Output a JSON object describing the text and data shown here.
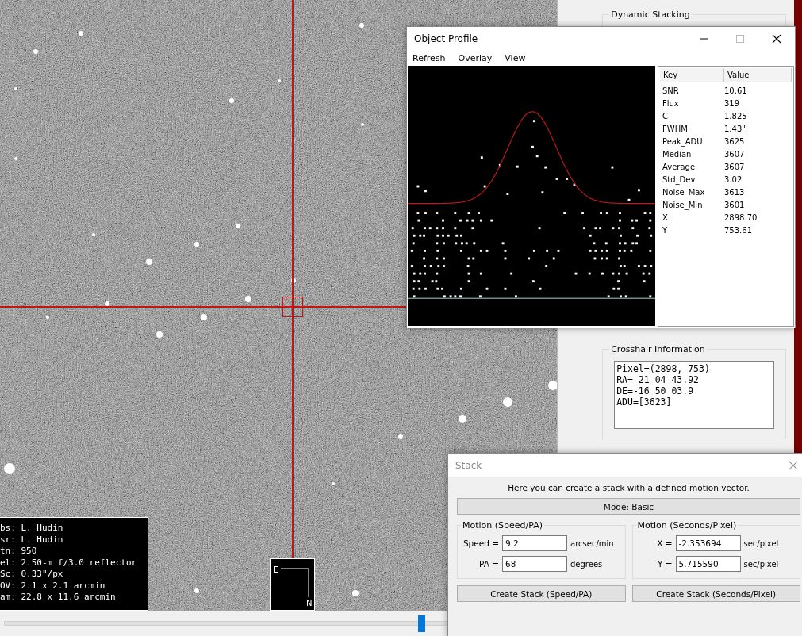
{
  "image_viewer": {
    "info_lines": [
      "bs: L. Hudin",
      "sr: L. Hudin",
      "tn: 950",
      "el: 2.50-m f/3.0 reflector",
      "Sc: 0.33\"/px",
      "OV: 2.1 x 2.1 arcmin",
      "am: 22.8 x 11.6 arcmin"
    ],
    "compass": {
      "east": "E",
      "north": "N"
    }
  },
  "zoom_slider": {
    "level": 0.94
  },
  "side_panel": {
    "dynamic_stacking": {
      "title": "Dynamic Stacking"
    },
    "crosshair_info": {
      "title": "Crosshair Information",
      "lines": [
        "Pixel=(2898, 753)",
        "RA= 21 04 43.92",
        "DE=-16 50 03.9",
        "ADU=[3623]"
      ]
    }
  },
  "object_profile": {
    "title": "Object Profile",
    "menu": [
      "Refresh",
      "Overlay",
      "View"
    ],
    "table": {
      "columns": [
        "Key",
        "Value"
      ],
      "rows": [
        [
          "SNR",
          "10.61"
        ],
        [
          "Flux",
          "319"
        ],
        [
          "C",
          "1.825"
        ],
        [
          "FWHM",
          "1.43\""
        ],
        [
          "Peak_ADU",
          "3625"
        ],
        [
          "Median",
          "3607"
        ],
        [
          "Average",
          "3607"
        ],
        [
          "Std_Dev",
          "3.02"
        ],
        [
          "Noise_Max",
          "3613"
        ],
        [
          "Noise_Min",
          "3601"
        ],
        [
          "X",
          "2898.70"
        ],
        [
          "Y",
          "753.61"
        ]
      ]
    }
  },
  "stack_dialog": {
    "title": "Stack",
    "intro": "Here you can create a stack with a defined motion vector.",
    "mode_button": "Mode: Basic",
    "groups": [
      {
        "title": "Motion (Speed/PA)",
        "fields": [
          {
            "label": "Speed =",
            "value": "9.2",
            "unit": "arcsec/min"
          },
          {
            "label": "PA =",
            "value": "68",
            "unit": "degrees"
          }
        ],
        "button": "Create Stack (Speed/PA)"
      },
      {
        "title": "Motion (Seconds/Pixel)",
        "fields": [
          {
            "label": "X =",
            "value": "-2.353694",
            "unit": "sec/pixel"
          },
          {
            "label": "Y =",
            "value": "5.715590",
            "unit": "sec/pixel"
          }
        ],
        "button": "Create Stack (Seconds/Pixel)"
      }
    ]
  }
}
